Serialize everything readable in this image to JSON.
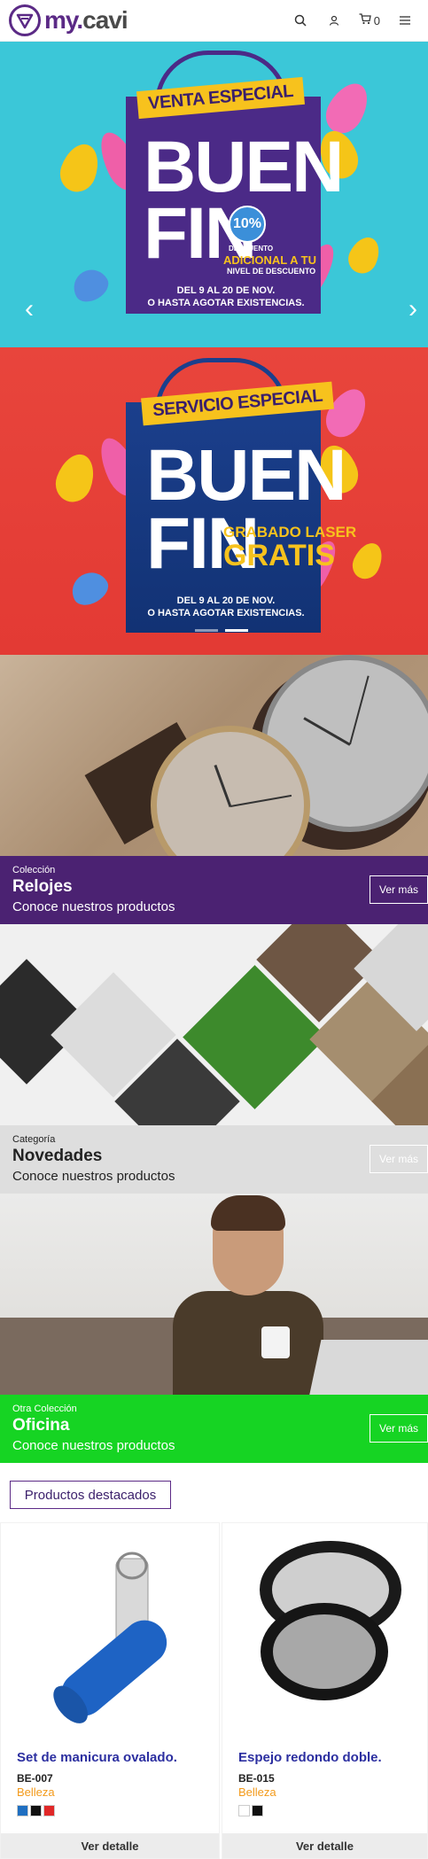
{
  "header": {
    "logo_brand_my": "my",
    "logo_brand_dot": ".",
    "logo_brand_cavi": "cavi",
    "cart_count": "0",
    "icons": [
      "search-icon",
      "user-icon",
      "cart-icon",
      "menu-icon"
    ]
  },
  "hero": {
    "slide1": {
      "tag": "VENTA ESPECIAL",
      "line1": "BUEN",
      "line2": "FIN",
      "badge": "10%",
      "promo_small": "DESCUENTO",
      "promo_line1": "ADICIONAL A TU",
      "promo_line2": "NIVEL DE DESCUENTO",
      "dates_line1": "DEL 9 AL 20 DE NOV.",
      "dates_line2": "O HASTA AGOTAR EXISTENCIAS."
    },
    "slide2": {
      "tag": "SERVICIO ESPECIAL",
      "line1": "BUEN",
      "line2": "FIN",
      "promo_line1": "GRABADO LASER",
      "promo_line2": "GRATIS",
      "dates_line1": "DEL 9 AL 20 DE NOV.",
      "dates_line2": "O HASTA AGOTAR EXISTENCIAS."
    },
    "prev_arrow": "‹",
    "next_arrow": "›"
  },
  "collections": [
    {
      "kicker": "Colección",
      "title": "Relojes",
      "subtitle": "Conoce nuestros productos",
      "button": "Ver más",
      "color": "#4b2272"
    },
    {
      "kicker": "Categoría",
      "title": "Novedades",
      "subtitle": "Conoce nuestros productos",
      "button": "Ver más",
      "color": "#dedede"
    },
    {
      "kicker": "Otra Colección",
      "title": "Oficina",
      "subtitle": "Conoce nuestros productos",
      "button": "Ver más",
      "color": "#16d423"
    }
  ],
  "featured": {
    "label": "Productos destacados",
    "products": [
      {
        "name": "Set de manicura ovalado.",
        "code": "BE-007",
        "category": "Belleza",
        "swatches": [
          "#1f6fc1",
          "#111111",
          "#e02828"
        ],
        "button": "Ver detalle"
      },
      {
        "name": "Espejo redondo doble.",
        "code": "BE-015",
        "category": "Belleza",
        "swatches": [
          "#ffffff",
          "#111111"
        ],
        "button": "Ver detalle"
      }
    ]
  },
  "colors": {
    "brand_purple": "#5b2a86",
    "accent_orange": "#f39a1a",
    "product_title_blue": "#2c2fa0"
  }
}
